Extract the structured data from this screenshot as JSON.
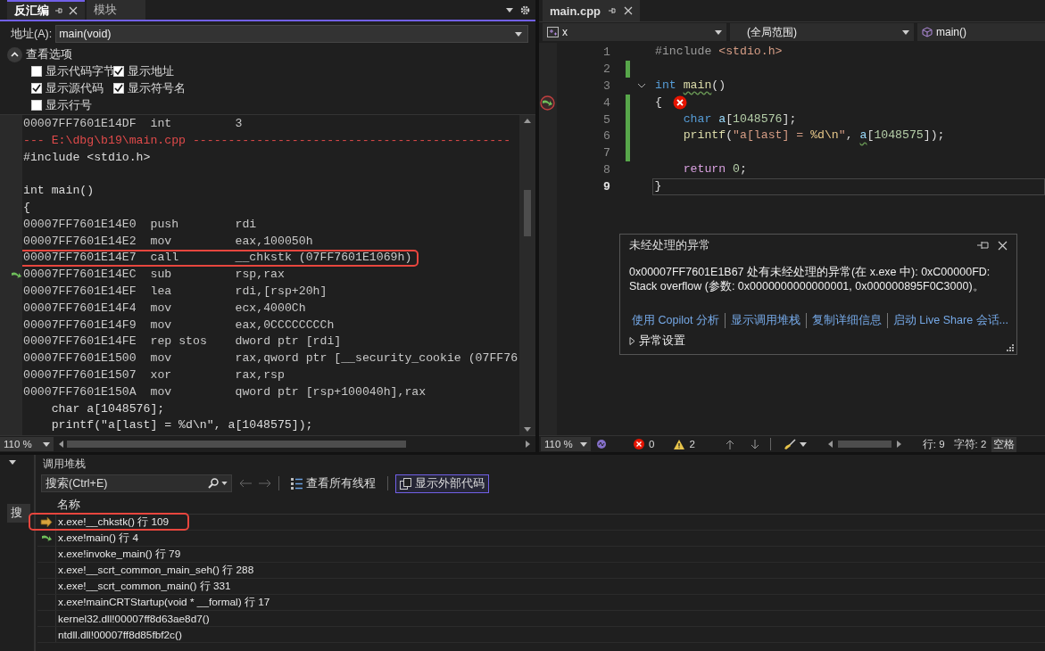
{
  "disassembly": {
    "tabs": [
      {
        "label": "反汇编",
        "selected": true
      },
      {
        "label": "模块",
        "selected": false
      }
    ],
    "address_label": "地址(A):",
    "address_value": "main(void)",
    "options": {
      "title": "查看选项",
      "expanded": true,
      "checkboxes": [
        {
          "label": "显示代码字节",
          "checked": false
        },
        {
          "label": "显示地址",
          "checked": true
        },
        {
          "label": "显示源代码",
          "checked": true
        },
        {
          "label": "显示符号名",
          "checked": true
        },
        {
          "label": "显示行号",
          "checked": false
        }
      ]
    },
    "lines": [
      {
        "kind": "asm",
        "address": "00007FF7601E14DF",
        "op": "int",
        "args": "3",
        "current": false,
        "annotated": false
      },
      {
        "kind": "file",
        "text": "--- E:\\dbg\\b19\\main.cpp ---------------------------------------------"
      },
      {
        "kind": "source",
        "text": "#include <stdio.h>"
      },
      {
        "kind": "blank"
      },
      {
        "kind": "source",
        "text": "int main()"
      },
      {
        "kind": "source",
        "text": "{"
      },
      {
        "kind": "asm",
        "address": "00007FF7601E14E0",
        "op": "push",
        "args": "rdi",
        "current": false,
        "annotated": false
      },
      {
        "kind": "asm",
        "address": "00007FF7601E14E2",
        "op": "mov",
        "args": "eax,100050h",
        "current": false,
        "annotated": false
      },
      {
        "kind": "asm",
        "address": "00007FF7601E14E7",
        "op": "call",
        "args": "__chkstk (07FF7601E1069h)",
        "current": false,
        "annotated": true
      },
      {
        "kind": "asm",
        "address": "00007FF7601E14EC",
        "op": "sub",
        "args": "rsp,rax",
        "current": true,
        "annotated": false
      },
      {
        "kind": "asm",
        "address": "00007FF7601E14EF",
        "op": "lea",
        "args": "rdi,[rsp+20h]",
        "current": false,
        "annotated": false
      },
      {
        "kind": "asm",
        "address": "00007FF7601E14F4",
        "op": "mov",
        "args": "ecx,4000Ch",
        "current": false,
        "annotated": false
      },
      {
        "kind": "asm",
        "address": "00007FF7601E14F9",
        "op": "mov",
        "args": "eax,0CCCCCCCCh",
        "current": false,
        "annotated": false
      },
      {
        "kind": "asm",
        "address": "00007FF7601E14FE",
        "op": "rep stos",
        "args": "dword ptr [rdi]",
        "current": false,
        "annotated": false
      },
      {
        "kind": "asm",
        "address": "00007FF7601E1500",
        "op": "mov",
        "args": "rax,qword ptr [__security_cookie (07FF76",
        "current": false,
        "annotated": false
      },
      {
        "kind": "asm",
        "address": "00007FF7601E1507",
        "op": "xor",
        "args": "rax,rsp",
        "current": false,
        "annotated": false
      },
      {
        "kind": "asm",
        "address": "00007FF7601E150A",
        "op": "mov",
        "args": "qword ptr [rsp+100040h],rax",
        "current": false,
        "annotated": false
      },
      {
        "kind": "source",
        "text": "    char a[1048576];"
      },
      {
        "kind": "source",
        "text": "    printf(\"a[last] = %d\\n\", a[1048575]);"
      }
    ],
    "zoom": "110 %"
  },
  "editor": {
    "tab": {
      "label": "main.cpp",
      "selected": true
    },
    "nav": {
      "project": "x",
      "scope": "(全局范围)",
      "member": "main()"
    },
    "lines": [
      {
        "number": "1",
        "changed": false,
        "fold": false,
        "exception": false,
        "current": false,
        "tokens": [
          {
            "text": "#include ",
            "kind": "preprocessor"
          },
          {
            "text": "<stdio.h>",
            "kind": "string"
          }
        ]
      },
      {
        "number": "2",
        "changed": true,
        "fold": false,
        "exception": false,
        "current": false
      },
      {
        "number": "3",
        "changed": false,
        "fold": true,
        "exception": false,
        "current": false,
        "tokens": [
          {
            "text": "int ",
            "kind": "keyword"
          },
          {
            "text": "main",
            "kind": "function",
            "squiggle": true
          },
          {
            "text": "()",
            "kind": "punctuation"
          }
        ]
      },
      {
        "number": "4",
        "changed": true,
        "fold": false,
        "exception": true,
        "current": false,
        "tokens": [
          {
            "text": "{",
            "kind": "punctuation"
          }
        ]
      },
      {
        "number": "5",
        "changed": true,
        "fold": false,
        "exception": false,
        "current": false,
        "tokens": [
          {
            "text": "    char ",
            "kind": "keyword"
          },
          {
            "text": "a",
            "kind": "variable"
          },
          {
            "text": "[",
            "kind": "punctuation"
          },
          {
            "text": "1048576",
            "kind": "number"
          },
          {
            "text": "];",
            "kind": "punctuation"
          }
        ]
      },
      {
        "number": "6",
        "changed": true,
        "fold": false,
        "exception": false,
        "current": false,
        "tokens": [
          {
            "text": "    printf",
            "kind": "function"
          },
          {
            "text": "(",
            "kind": "punctuation"
          },
          {
            "text": "\"a[last] = ",
            "kind": "string"
          },
          {
            "text": "%d\\n",
            "kind": "escape"
          },
          {
            "text": "\"",
            "kind": "string"
          },
          {
            "text": ", ",
            "kind": "punctuation"
          },
          {
            "text": "a",
            "kind": "variable",
            "squiggle": true
          },
          {
            "text": "[",
            "kind": "punctuation"
          },
          {
            "text": "1048575",
            "kind": "number"
          },
          {
            "text": "]);",
            "kind": "punctuation"
          }
        ]
      },
      {
        "number": "7",
        "changed": true,
        "fold": false,
        "exception": false,
        "current": false
      },
      {
        "number": "8",
        "changed": false,
        "fold": false,
        "exception": false,
        "current": false,
        "tokens": [
          {
            "text": "    return ",
            "kind": "control"
          },
          {
            "text": "0",
            "kind": "number"
          },
          {
            "text": ";",
            "kind": "punctuation"
          }
        ]
      },
      {
        "number": "9",
        "changed": false,
        "fold": false,
        "exception": false,
        "current": true,
        "tokens": [
          {
            "text": "}",
            "kind": "punctuation"
          }
        ]
      }
    ],
    "exception_popup": {
      "title": "未经处理的异常",
      "message": "0x00007FF7601E1B67 处有未经处理的异常(在 x.exe 中): 0xC00000FD: Stack overflow (参数: 0x0000000000000001, 0x000000895F0C3000)。",
      "links": [
        "使用 Copilot 分析",
        "显示调用堆栈",
        "复制详细信息",
        "启动 Live Share 会话..."
      ],
      "settings": {
        "label": "异常设置",
        "expanded": false
      }
    },
    "status_bar": {
      "zoom": "110 %",
      "errors": "0",
      "warnings": "2",
      "line": "行: 9",
      "column": "字符: 2",
      "whitespace": "空格"
    }
  },
  "call_stack": {
    "side_tab": "搜",
    "title": "调用堆栈",
    "search": {
      "placeholder": "搜索(Ctrl+E)"
    },
    "buttons": [
      {
        "label": "查看所有线程",
        "selected": false
      },
      {
        "label": "显示外部代码",
        "selected": true
      }
    ],
    "column": "名称",
    "rows": [
      {
        "name": "x.exe!__chkstk() 行 109",
        "kind": "current",
        "annotated": true
      },
      {
        "name": "x.exe!main() 行 4",
        "kind": "caller",
        "annotated": false
      },
      {
        "name": "x.exe!invoke_main() 行 79",
        "kind": "plain",
        "annotated": false
      },
      {
        "name": "x.exe!__scrt_common_main_seh() 行 288",
        "kind": "plain",
        "annotated": false
      },
      {
        "name": "x.exe!__scrt_common_main() 行 331",
        "kind": "plain",
        "annotated": false
      },
      {
        "name": "x.exe!mainCRTStartup(void * __formal) 行 17",
        "kind": "plain",
        "annotated": false
      },
      {
        "name": "kernel32.dll!00007ff8d63ae8d7()",
        "kind": "plain",
        "annotated": false
      },
      {
        "name": "ntdll.dll!00007ff8d85fbf2c()",
        "kind": "plain",
        "annotated": false
      }
    ]
  }
}
